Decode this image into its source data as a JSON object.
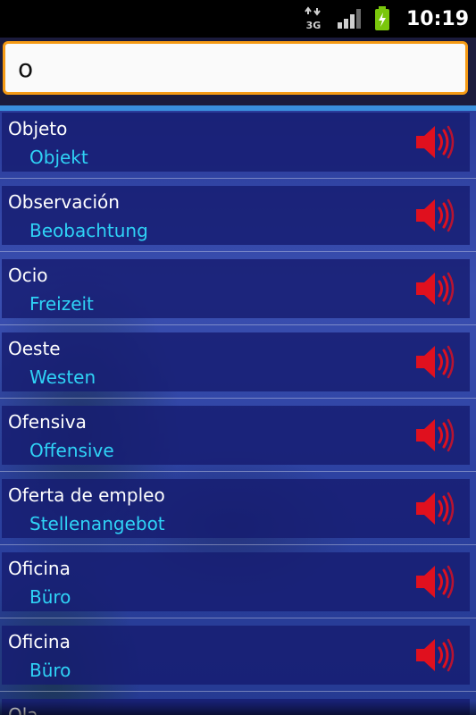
{
  "status_bar": {
    "network_label": "3G",
    "time": "10:19",
    "icons": [
      "data-3g-icon",
      "signal-strength-icon",
      "battery-charging-icon"
    ]
  },
  "search": {
    "value": "o",
    "placeholder": ""
  },
  "results": [
    {
      "term": "Objeto",
      "translation": "Objekt"
    },
    {
      "term": "Observación",
      "translation": "Beobachtung"
    },
    {
      "term": "Ocio",
      "translation": "Freizeit"
    },
    {
      "term": "Oeste",
      "translation": "Westen"
    },
    {
      "term": "Ofensiva",
      "translation": "Offensive"
    },
    {
      "term": "Oferta de empleo",
      "translation": "Stellenangebot"
    },
    {
      "term": "Oficina",
      "translation": "Büro"
    },
    {
      "term": "Oficina",
      "translation": "Büro"
    },
    {
      "term": "Ola",
      "translation": ""
    }
  ],
  "colors": {
    "accent_border": "#f59a14",
    "term_text": "#ffffff",
    "translation_text": "#2fd3f6",
    "speaker_icon": "#e0101e",
    "battery": "#7ac70c"
  }
}
